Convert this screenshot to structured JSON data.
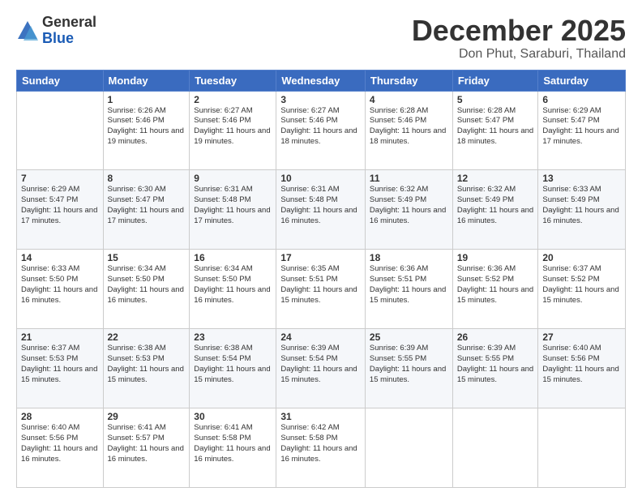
{
  "logo": {
    "general": "General",
    "blue": "Blue"
  },
  "title": "December 2025",
  "subtitle": "Don Phut, Saraburi, Thailand",
  "headers": [
    "Sunday",
    "Monday",
    "Tuesday",
    "Wednesday",
    "Thursday",
    "Friday",
    "Saturday"
  ],
  "weeks": [
    [
      {
        "day": "",
        "sunrise": "",
        "sunset": "",
        "daylight": ""
      },
      {
        "day": "1",
        "sunrise": "Sunrise: 6:26 AM",
        "sunset": "Sunset: 5:46 PM",
        "daylight": "Daylight: 11 hours and 19 minutes."
      },
      {
        "day": "2",
        "sunrise": "Sunrise: 6:27 AM",
        "sunset": "Sunset: 5:46 PM",
        "daylight": "Daylight: 11 hours and 19 minutes."
      },
      {
        "day": "3",
        "sunrise": "Sunrise: 6:27 AM",
        "sunset": "Sunset: 5:46 PM",
        "daylight": "Daylight: 11 hours and 18 minutes."
      },
      {
        "day": "4",
        "sunrise": "Sunrise: 6:28 AM",
        "sunset": "Sunset: 5:46 PM",
        "daylight": "Daylight: 11 hours and 18 minutes."
      },
      {
        "day": "5",
        "sunrise": "Sunrise: 6:28 AM",
        "sunset": "Sunset: 5:47 PM",
        "daylight": "Daylight: 11 hours and 18 minutes."
      },
      {
        "day": "6",
        "sunrise": "Sunrise: 6:29 AM",
        "sunset": "Sunset: 5:47 PM",
        "daylight": "Daylight: 11 hours and 17 minutes."
      }
    ],
    [
      {
        "day": "7",
        "sunrise": "Sunrise: 6:29 AM",
        "sunset": "Sunset: 5:47 PM",
        "daylight": "Daylight: 11 hours and 17 minutes."
      },
      {
        "day": "8",
        "sunrise": "Sunrise: 6:30 AM",
        "sunset": "Sunset: 5:47 PM",
        "daylight": "Daylight: 11 hours and 17 minutes."
      },
      {
        "day": "9",
        "sunrise": "Sunrise: 6:31 AM",
        "sunset": "Sunset: 5:48 PM",
        "daylight": "Daylight: 11 hours and 17 minutes."
      },
      {
        "day": "10",
        "sunrise": "Sunrise: 6:31 AM",
        "sunset": "Sunset: 5:48 PM",
        "daylight": "Daylight: 11 hours and 16 minutes."
      },
      {
        "day": "11",
        "sunrise": "Sunrise: 6:32 AM",
        "sunset": "Sunset: 5:49 PM",
        "daylight": "Daylight: 11 hours and 16 minutes."
      },
      {
        "day": "12",
        "sunrise": "Sunrise: 6:32 AM",
        "sunset": "Sunset: 5:49 PM",
        "daylight": "Daylight: 11 hours and 16 minutes."
      },
      {
        "day": "13",
        "sunrise": "Sunrise: 6:33 AM",
        "sunset": "Sunset: 5:49 PM",
        "daylight": "Daylight: 11 hours and 16 minutes."
      }
    ],
    [
      {
        "day": "14",
        "sunrise": "Sunrise: 6:33 AM",
        "sunset": "Sunset: 5:50 PM",
        "daylight": "Daylight: 11 hours and 16 minutes."
      },
      {
        "day": "15",
        "sunrise": "Sunrise: 6:34 AM",
        "sunset": "Sunset: 5:50 PM",
        "daylight": "Daylight: 11 hours and 16 minutes."
      },
      {
        "day": "16",
        "sunrise": "Sunrise: 6:34 AM",
        "sunset": "Sunset: 5:50 PM",
        "daylight": "Daylight: 11 hours and 16 minutes."
      },
      {
        "day": "17",
        "sunrise": "Sunrise: 6:35 AM",
        "sunset": "Sunset: 5:51 PM",
        "daylight": "Daylight: 11 hours and 15 minutes."
      },
      {
        "day": "18",
        "sunrise": "Sunrise: 6:36 AM",
        "sunset": "Sunset: 5:51 PM",
        "daylight": "Daylight: 11 hours and 15 minutes."
      },
      {
        "day": "19",
        "sunrise": "Sunrise: 6:36 AM",
        "sunset": "Sunset: 5:52 PM",
        "daylight": "Daylight: 11 hours and 15 minutes."
      },
      {
        "day": "20",
        "sunrise": "Sunrise: 6:37 AM",
        "sunset": "Sunset: 5:52 PM",
        "daylight": "Daylight: 11 hours and 15 minutes."
      }
    ],
    [
      {
        "day": "21",
        "sunrise": "Sunrise: 6:37 AM",
        "sunset": "Sunset: 5:53 PM",
        "daylight": "Daylight: 11 hours and 15 minutes."
      },
      {
        "day": "22",
        "sunrise": "Sunrise: 6:38 AM",
        "sunset": "Sunset: 5:53 PM",
        "daylight": "Daylight: 11 hours and 15 minutes."
      },
      {
        "day": "23",
        "sunrise": "Sunrise: 6:38 AM",
        "sunset": "Sunset: 5:54 PM",
        "daylight": "Daylight: 11 hours and 15 minutes."
      },
      {
        "day": "24",
        "sunrise": "Sunrise: 6:39 AM",
        "sunset": "Sunset: 5:54 PM",
        "daylight": "Daylight: 11 hours and 15 minutes."
      },
      {
        "day": "25",
        "sunrise": "Sunrise: 6:39 AM",
        "sunset": "Sunset: 5:55 PM",
        "daylight": "Daylight: 11 hours and 15 minutes."
      },
      {
        "day": "26",
        "sunrise": "Sunrise: 6:39 AM",
        "sunset": "Sunset: 5:55 PM",
        "daylight": "Daylight: 11 hours and 15 minutes."
      },
      {
        "day": "27",
        "sunrise": "Sunrise: 6:40 AM",
        "sunset": "Sunset: 5:56 PM",
        "daylight": "Daylight: 11 hours and 15 minutes."
      }
    ],
    [
      {
        "day": "28",
        "sunrise": "Sunrise: 6:40 AM",
        "sunset": "Sunset: 5:56 PM",
        "daylight": "Daylight: 11 hours and 16 minutes."
      },
      {
        "day": "29",
        "sunrise": "Sunrise: 6:41 AM",
        "sunset": "Sunset: 5:57 PM",
        "daylight": "Daylight: 11 hours and 16 minutes."
      },
      {
        "day": "30",
        "sunrise": "Sunrise: 6:41 AM",
        "sunset": "Sunset: 5:58 PM",
        "daylight": "Daylight: 11 hours and 16 minutes."
      },
      {
        "day": "31",
        "sunrise": "Sunrise: 6:42 AM",
        "sunset": "Sunset: 5:58 PM",
        "daylight": "Daylight: 11 hours and 16 minutes."
      },
      {
        "day": "",
        "sunrise": "",
        "sunset": "",
        "daylight": ""
      },
      {
        "day": "",
        "sunrise": "",
        "sunset": "",
        "daylight": ""
      },
      {
        "day": "",
        "sunrise": "",
        "sunset": "",
        "daylight": ""
      }
    ]
  ]
}
